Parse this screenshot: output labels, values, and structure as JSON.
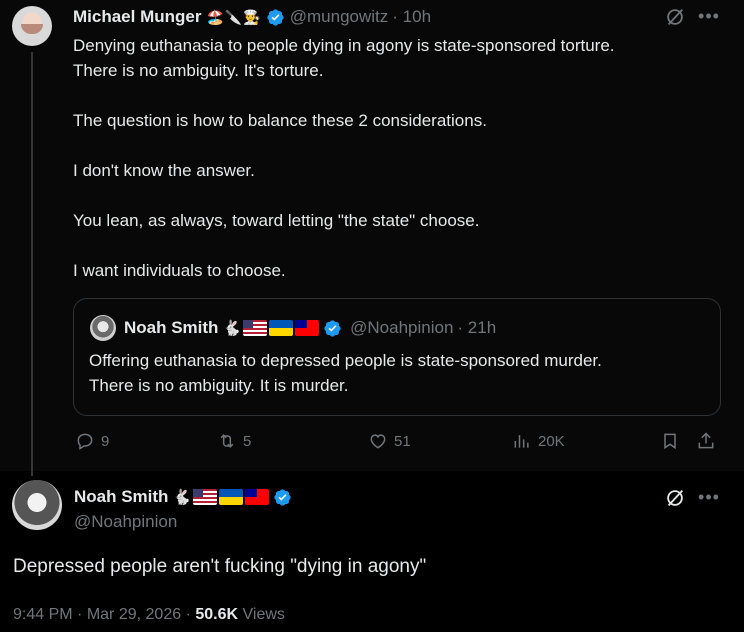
{
  "colors": {
    "background": "#000000",
    "card_background": "#080808",
    "text": "#e7e9ea",
    "muted": "#71767b",
    "verified_blue": "#1d9bf0",
    "border": "#2f3336"
  },
  "reply_tweet": {
    "author_name": "Michael Munger",
    "author_emoji": "🏖️🔪👨‍🍳",
    "handle": "@mungowitz",
    "time": "· 10h",
    "text": "Denying euthanasia to people dying in agony is state-sponsored torture.\nThere is no ambiguity. It's torture.\n\nThe question is how to balance these 2 considerations.\n\nI don't know the answer.\n\nYou lean, as always, toward letting \"the state\" choose.\n\nI want individuals to choose.",
    "quoted": {
      "author_name": "Noah Smith",
      "handle": "@Noahpinion",
      "time": "· 21h",
      "text": "Offering euthanasia to depressed people is state-sponsored murder.\nThere is no ambiguity. It is murder."
    },
    "actions": {
      "replies": "9",
      "reposts": "5",
      "likes": "51",
      "views": "20K"
    }
  },
  "main_tweet": {
    "author_name": "Noah Smith",
    "handle": "@Noahpinion",
    "text": "Depressed people aren't fucking \"dying in agony\"",
    "time": "9:44 PM",
    "date": "Mar 29, 2026",
    "views_count": "50.6K",
    "views_label": "Views"
  },
  "icons": {
    "more": "more-icon",
    "grok": "grok-icon",
    "reply": "reply-icon",
    "repost": "repost-icon",
    "like": "heart-icon",
    "views": "views-icon",
    "bookmark": "bookmark-icon",
    "share": "share-icon",
    "verified": "verified-badge-icon"
  }
}
